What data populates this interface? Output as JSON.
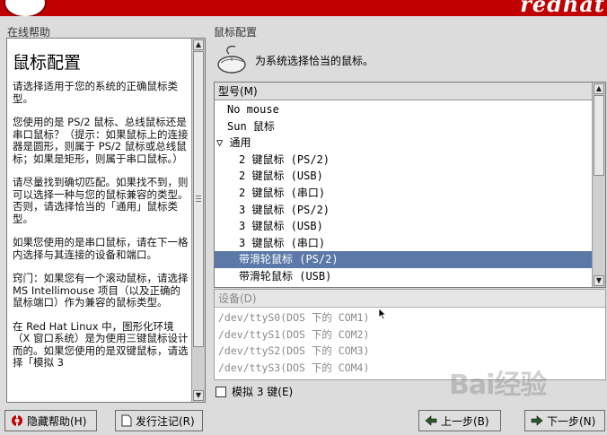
{
  "banner": {
    "brand_text": "redhat"
  },
  "help": {
    "section_label": "在线帮助",
    "title": "鼠标配置",
    "paragraphs": [
      "请选择适用于您的系统的正确鼠标类型。",
      "您使用的是 PS/2 鼠标、总线鼠标还是串口鼠标？（提示：如果鼠标上的连接器是圆形，则属于 PS/2 鼠标或总线鼠标；如果是矩形，则属于串口鼠标。）",
      "请尽量找到确切匹配。如果找不到，则可以选择一种与您的鼠标兼容的类型。否则，请选择恰当的「通用」鼠标类型。",
      "如果您使用的是串口鼠标，请在下一格内选择与其连接的设备和端口。",
      "窍门：如果您有一个滚动鼠标，请选择 MS Intellimouse 项目（以及正确的鼠标端口）作为兼容的鼠标类型。",
      "在 Red Hat Linux 中，图形化环境（X 窗口系统）是为使用三键鼠标设计而的。如果您使用的是双键鼠标，请选择「模拟 3"
    ]
  },
  "mouse": {
    "section_label": "鼠标配置",
    "heading": "为系统选择恰当的鼠标。",
    "list_header": "型号(M)",
    "items": [
      {
        "label": "No mouse",
        "level": "top"
      },
      {
        "label": "Sun 鼠标",
        "level": "top"
      },
      {
        "label": "▽ 通用",
        "level": "group"
      },
      {
        "label": "2 键鼠标 (PS/2)",
        "level": "child"
      },
      {
        "label": "2 键鼠标 (USB)",
        "level": "child"
      },
      {
        "label": "2 键鼠标 (串口)",
        "level": "child"
      },
      {
        "label": "3 键鼠标 (PS/2)",
        "level": "child"
      },
      {
        "label": "3 键鼠标 (USB)",
        "level": "child"
      },
      {
        "label": "3 键鼠标 (串口)",
        "level": "child"
      },
      {
        "label": "带滑轮鼠标 (PS/2)",
        "level": "child",
        "selected": true
      },
      {
        "label": "带滑轮鼠标 (USB)",
        "level": "child"
      }
    ],
    "device_header": "设备(D)",
    "devices": [
      "/dev/ttyS0(DOS 下的 COM1)",
      "/dev/ttyS1(DOS 下的 COM2)",
      "/dev/ttyS2(DOS 下的 COM3)",
      "/dev/ttyS3(DOS 下的 COM4)"
    ],
    "emulate_label": "模拟 3 键(E)"
  },
  "buttons": {
    "hide_help": "隐藏帮助(H)",
    "release_notes": "发行注记(R)",
    "back": "上一步(B)",
    "next": "下一步(N)"
  },
  "watermark": "Bai经验",
  "colors": {
    "banner": "#c00000",
    "selection": "#5b78a6"
  }
}
